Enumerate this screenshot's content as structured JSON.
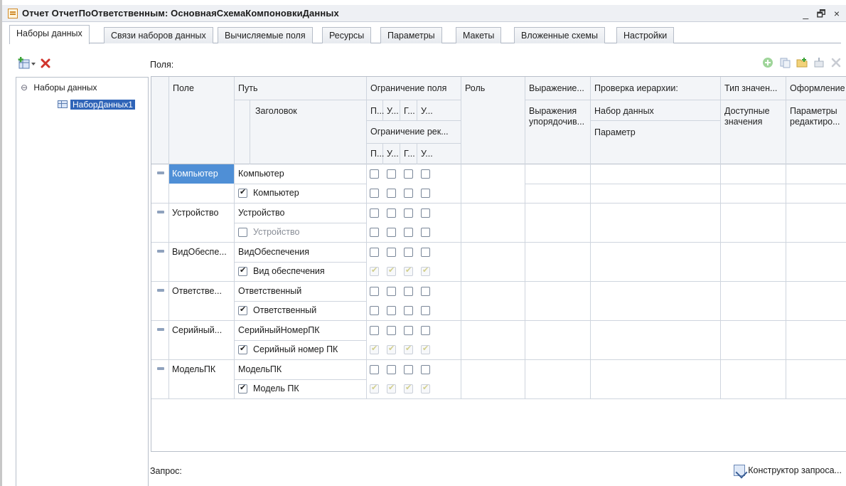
{
  "window": {
    "title": "Отчет ОтчетПоОтветственным: ОсновнаяСхемаКомпоновкиДанных",
    "controls": [
      "_",
      "🗗",
      "×"
    ]
  },
  "tabs": [
    {
      "label": "Наборы данных",
      "active": true
    },
    {
      "label": "Связи наборов данных",
      "active": false
    },
    {
      "label": "Вычисляемые поля",
      "active": false
    },
    {
      "label": "Ресурсы",
      "active": false
    },
    {
      "label": "Параметры",
      "active": false
    },
    {
      "label": "Макеты",
      "active": false
    },
    {
      "label": "Вложенные схемы",
      "active": false
    },
    {
      "label": "Настройки",
      "active": false
    }
  ],
  "left": {
    "tree_root": "Наборы данных",
    "tree_child": "НаборДанных1",
    "collapse_glyph": "⊖"
  },
  "fields_label": "Поля:",
  "query_label": "Запрос:",
  "query_builder_label": "Конструктор запроса...",
  "headers": {
    "field": "Поле",
    "path": "Путь",
    "title": "Заголовок",
    "field_restriction": "Ограничение поля",
    "attr_restriction": "Ограничение рек...",
    "restriction_cols": [
      "П...",
      "У...",
      "Г...",
      "У..."
    ],
    "role": "Роль",
    "expression": "Выражение...",
    "order_expr": [
      "Выражения",
      "упорядочив..."
    ],
    "hierarchy_check": "Проверка иерархии:",
    "dataset": "Набор данных",
    "parameter": "Параметр",
    "value_type": "Тип значен...",
    "available_values": [
      "Доступные",
      "значения"
    ],
    "appearance": "Оформление",
    "edit_params": [
      "Параметры",
      "редактиро..."
    ]
  },
  "rows": [
    {
      "field": "Компьютер",
      "path": "Компьютер",
      "title": "Компьютер",
      "title_checked": true,
      "attr_style": "empty",
      "selected": true
    },
    {
      "field": "Устройство",
      "path": "Устройство",
      "title": "Устройство",
      "title_checked": false,
      "attr_style": "empty",
      "selected": false
    },
    {
      "field": "ВидОбеспе...",
      "path": "ВидОбеспечения",
      "title": "Вид обеспечения",
      "title_checked": true,
      "attr_style": "dim",
      "selected": false
    },
    {
      "field": "Ответстве...",
      "path": "Ответственный",
      "title": "Ответственный",
      "title_checked": true,
      "attr_style": "empty",
      "selected": false
    },
    {
      "field": "Серийный...",
      "path": "СерийныйНомерПК",
      "title": "Серийный номер ПК",
      "title_checked": true,
      "attr_style": "dim",
      "selected": false
    },
    {
      "field": "МодельПК",
      "path": "МодельПК",
      "title": "Модель ПК",
      "title_checked": true,
      "attr_style": "dim",
      "selected": false
    }
  ],
  "colors": {
    "selection": "#2f64b8",
    "cell_selection": "#4f8fd6",
    "delete_red": "#d0342c",
    "add_green": "#3aa335"
  },
  "icons": [
    "add-dataset-icon",
    "delete-icon",
    "add-field-icon",
    "copy-icon",
    "add-folder-icon",
    "move-icon",
    "remove-icon",
    "query-builder-icon"
  ]
}
